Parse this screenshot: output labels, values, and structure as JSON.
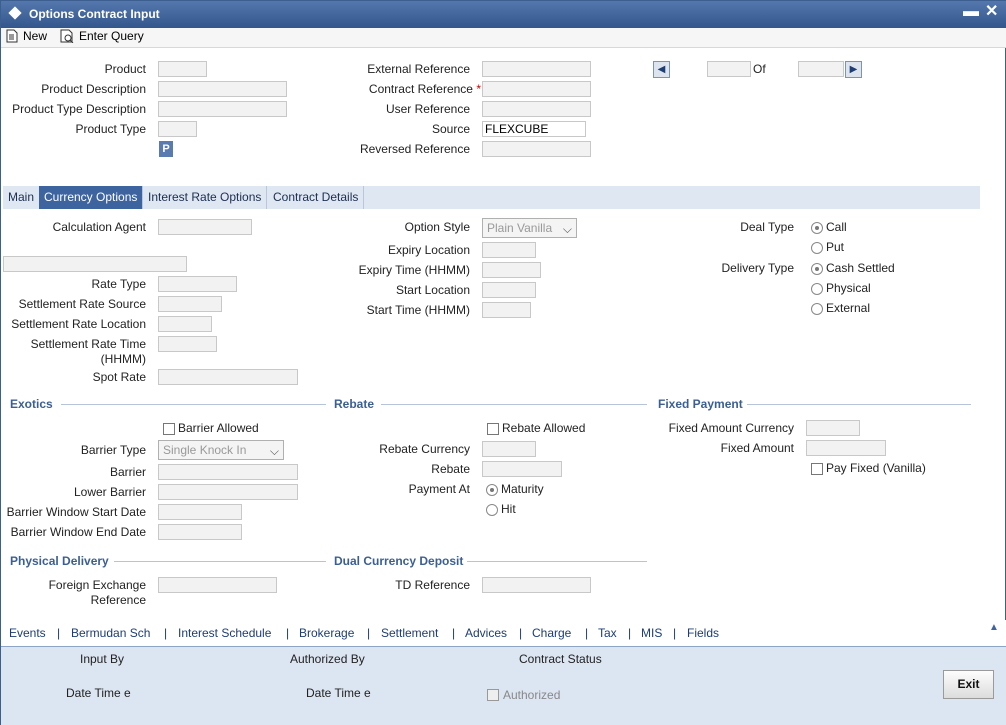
{
  "window": {
    "title": "Options Contract Input",
    "minimize": "▬",
    "close": "✕"
  },
  "toolbar": {
    "new": "New",
    "enter_query": "Enter Query"
  },
  "header": {
    "product": "Product",
    "product_description": "Product Description",
    "product_type_description": "Product Type Description",
    "product_type": "Product Type",
    "p_button": "P",
    "external_reference": "External Reference",
    "contract_reference": "Contract Reference",
    "required_mark": "*",
    "user_reference": "User Reference",
    "source": "Source",
    "source_value": "FLEXCUBE",
    "reversed_reference": "Reversed Reference",
    "of": "Of"
  },
  "tabs": [
    "Main",
    "Currency Options",
    "Interest Rate Options",
    "Contract Details"
  ],
  "currency_options": {
    "calculation_agent": "Calculation Agent",
    "rate_type": "Rate Type",
    "settlement_rate_source": "Settlement Rate Source",
    "settlement_rate_location": "Settlement Rate Location",
    "settlement_rate_time": "Settlement Rate Time (HHMM)",
    "spot_rate": "Spot Rate",
    "option_style": "Option Style",
    "option_style_value": "Plain Vanilla",
    "expiry_location": "Expiry Location",
    "expiry_time": "Expiry Time (HHMM)",
    "start_location": "Start Location",
    "start_time": "Start Time (HHMM)",
    "deal_type": "Deal Type",
    "call": "Call",
    "put": "Put",
    "delivery_type": "Delivery Type",
    "cash_settled": "Cash Settled",
    "physical": "Physical",
    "external": "External"
  },
  "exotics": {
    "section": "Exotics",
    "barrier_allowed": "Barrier Allowed",
    "barrier_type": "Barrier Type",
    "barrier_type_value": "Single Knock In",
    "barrier": "Barrier",
    "lower_barrier": "Lower Barrier",
    "barrier_window_start": "Barrier Window Start Date",
    "barrier_window_end": "Barrier Window End Date"
  },
  "rebate": {
    "section": "Rebate",
    "rebate_allowed": "Rebate Allowed",
    "rebate_currency": "Rebate Currency",
    "rebate": "Rebate",
    "payment_at": "Payment At",
    "maturity": "Maturity",
    "hit": "Hit"
  },
  "fixed_payment": {
    "section": "Fixed Payment",
    "fixed_amount_currency": "Fixed Amount Currency",
    "fixed_amount": "Fixed Amount",
    "pay_fixed": "Pay Fixed (Vanilla)"
  },
  "physical_delivery": {
    "section": "Physical Delivery",
    "fx_reference": "Foreign Exchange Reference"
  },
  "dual_currency": {
    "section": "Dual Currency Deposit",
    "td_reference": "TD Reference"
  },
  "bottom_nav": [
    "Events",
    "Bermudan Sch",
    "Interest Schedule",
    "Brokerage",
    "Settlement",
    "Advices",
    "Charge",
    "Tax",
    "MIS",
    "Fields"
  ],
  "footer": {
    "input_by": "Input By",
    "authorized_by": "Authorized By",
    "contract_status": "Contract Status",
    "date_time_1": "Date Time e",
    "date_time_2": "Date Time e",
    "authorized": "Authorized",
    "exit": "Exit"
  }
}
